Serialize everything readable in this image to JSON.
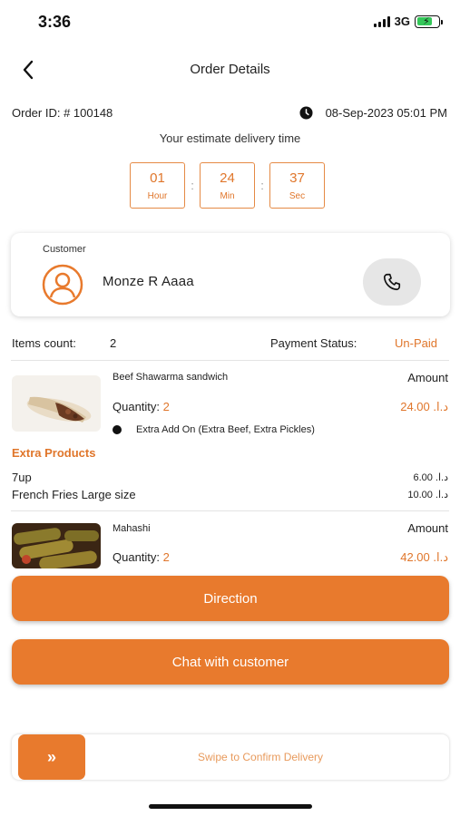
{
  "status_bar": {
    "time": "3:36",
    "network": "3G"
  },
  "header": {
    "title": "Order Details",
    "back_icon": "chevron-left-icon"
  },
  "order": {
    "id_text": "Order ID: # 100148",
    "datetime": "08-Sep-2023 05:01 PM",
    "estimate_label": "Your estimate delivery time"
  },
  "timer": [
    {
      "value": "01",
      "unit": "Hour"
    },
    {
      "value": "24",
      "unit": "Min"
    },
    {
      "value": "37",
      "unit": "Sec"
    }
  ],
  "timer_separator": ":",
  "customer": {
    "label": "Customer",
    "name": "Monze R Aaaa"
  },
  "summary": {
    "items_count_label": "Items count:",
    "items_count_value": "2",
    "payment_label": "Payment Status:",
    "payment_value": "Un-Paid"
  },
  "products": [
    {
      "name": "Beef Shawarma sandwich",
      "amount_label": "Amount",
      "quantity_label": "Quantity:",
      "quantity": "2",
      "price": "24.00 .د.ا",
      "addon": "Extra Add On (Extra Beef, Extra Pickles)"
    },
    {
      "name": "Mahashi",
      "amount_label": "Amount",
      "quantity_label": "Quantity:",
      "quantity": "2",
      "price": "42.00 .د.ا"
    }
  ],
  "extra_products": {
    "title": "Extra Products",
    "items": [
      {
        "name": "7up",
        "price": "6.00 .د.ا"
      },
      {
        "name": "French Fries Large size",
        "price": "10.00 .د.ا"
      }
    ]
  },
  "actions": {
    "direction": "Direction",
    "chat": "Chat with customer",
    "swipe_text": "Swipe to Confirm Delivery",
    "swipe_handle": "»"
  },
  "colors": {
    "accent": "#e87a2d",
    "accent_text": "#e0762b",
    "status_battery": "#34c759"
  }
}
